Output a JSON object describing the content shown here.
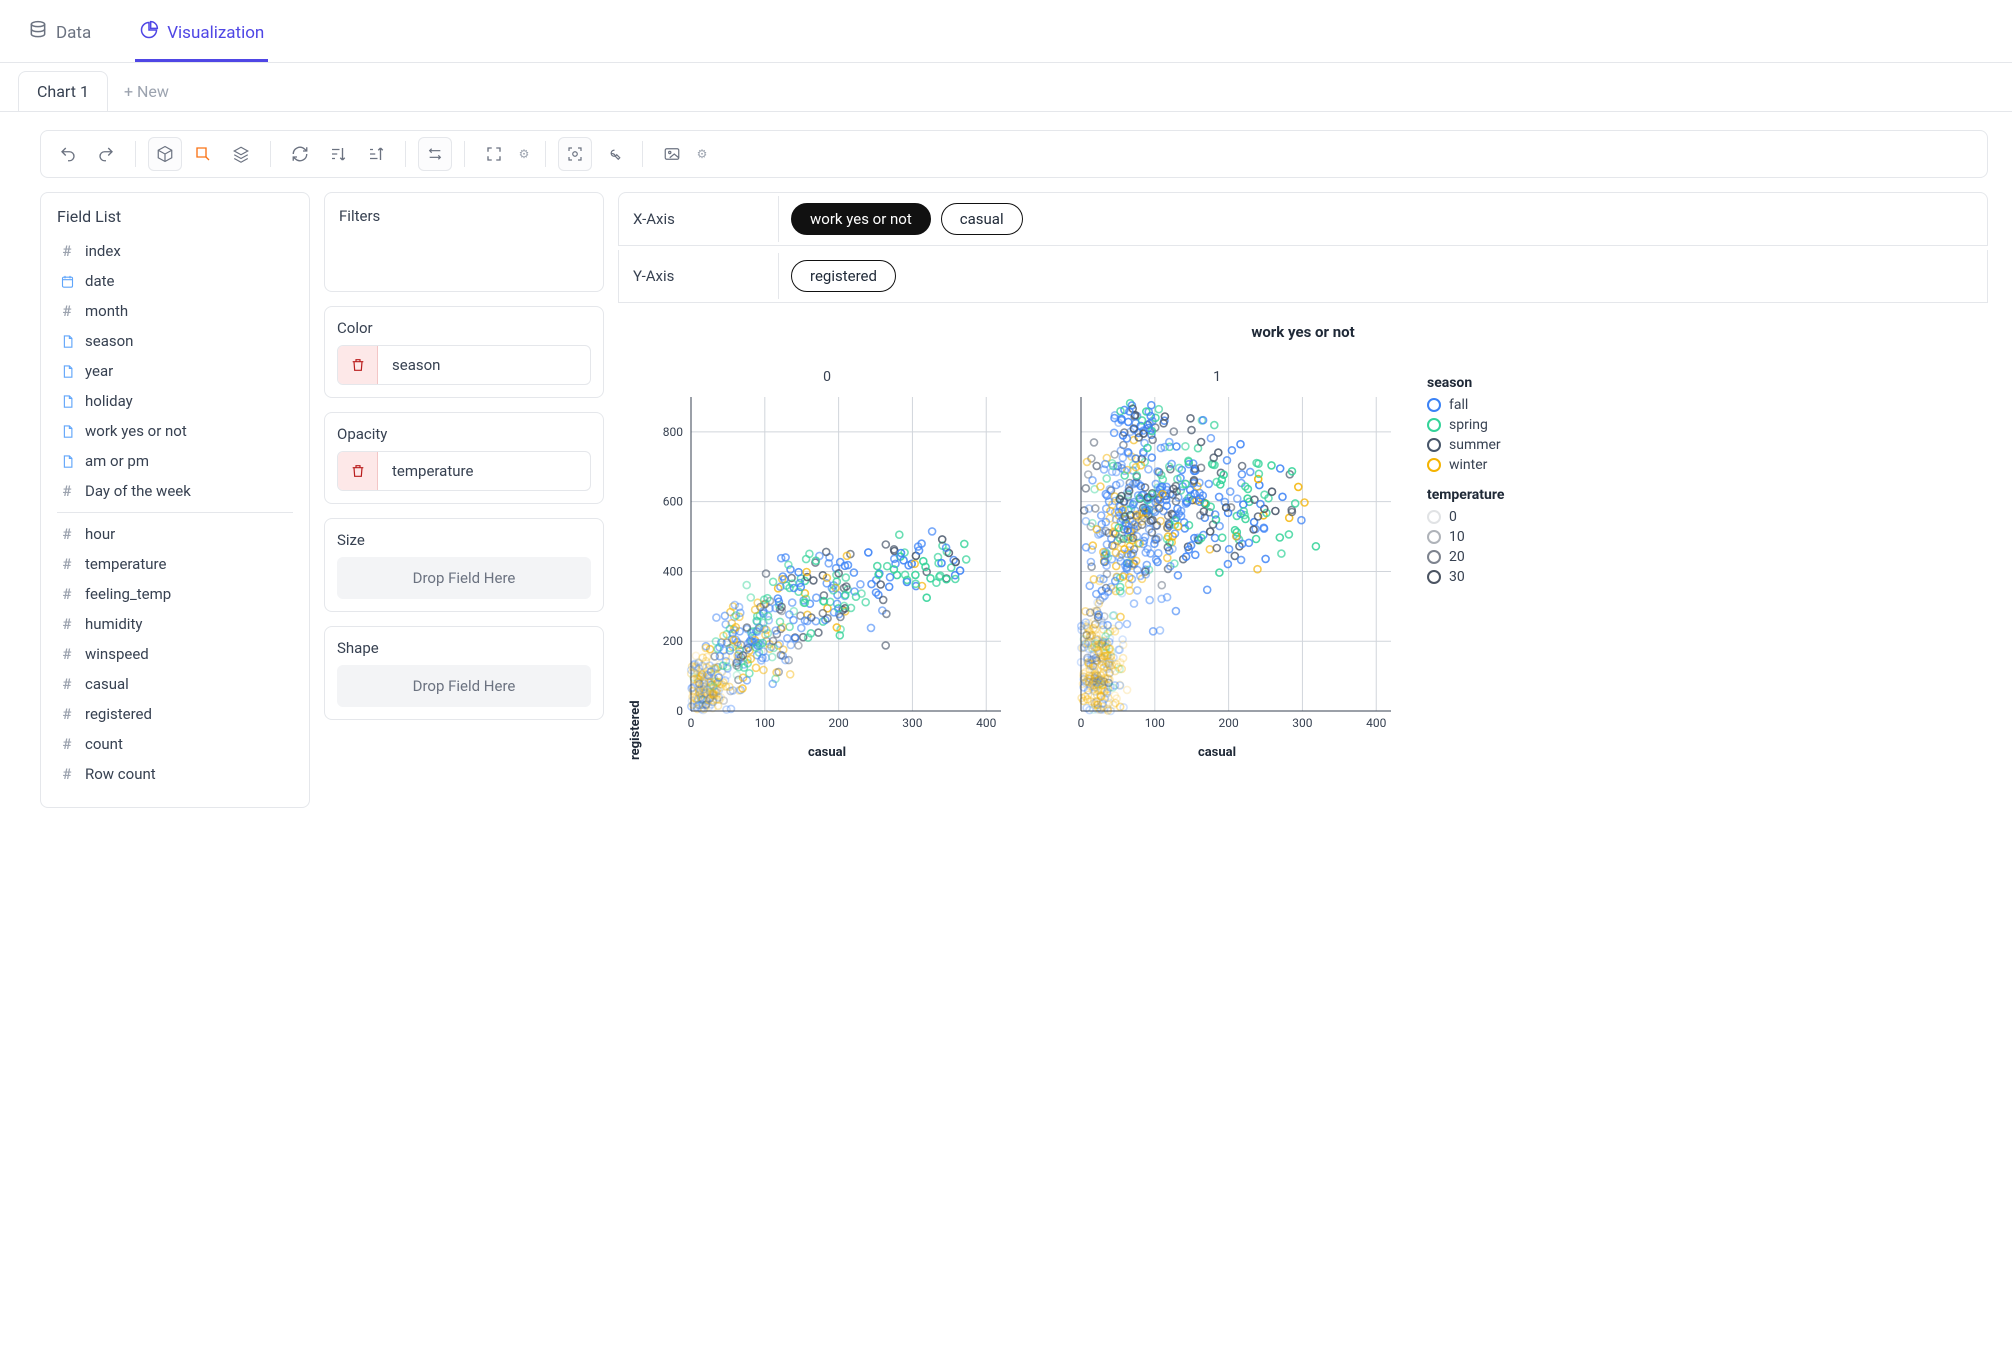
{
  "topTabs": {
    "data": "Data",
    "viz": "Visualization"
  },
  "subTabs": {
    "chart1": "Chart 1",
    "new": "+ New"
  },
  "fieldList": {
    "title": "Field List",
    "groups": [
      [
        {
          "icon": "hash",
          "label": "index"
        },
        {
          "icon": "cal",
          "label": "date"
        },
        {
          "icon": "hash",
          "label": "month"
        },
        {
          "icon": "doc",
          "label": "season"
        },
        {
          "icon": "doc",
          "label": "year"
        },
        {
          "icon": "doc",
          "label": "holiday"
        },
        {
          "icon": "doc",
          "label": "work yes or not"
        },
        {
          "icon": "doc",
          "label": "am or pm"
        },
        {
          "icon": "hash",
          "label": "Day of the week"
        }
      ],
      [
        {
          "icon": "hash",
          "label": "hour"
        },
        {
          "icon": "hash",
          "label": "temperature"
        },
        {
          "icon": "hash",
          "label": "feeling_temp"
        },
        {
          "icon": "hash",
          "label": "humidity"
        },
        {
          "icon": "hash",
          "label": "winspeed"
        },
        {
          "icon": "hash",
          "label": "casual"
        },
        {
          "icon": "hash",
          "label": "registered"
        },
        {
          "icon": "hash",
          "label": "count"
        },
        {
          "icon": "hash",
          "label": "Row count"
        }
      ]
    ]
  },
  "shelves": {
    "filters": "Filters",
    "color": {
      "title": "Color",
      "value": "season"
    },
    "opacity": {
      "title": "Opacity",
      "value": "temperature"
    },
    "size": {
      "title": "Size",
      "placeholder": "Drop Field Here"
    },
    "shape": {
      "title": "Shape",
      "placeholder": "Drop Field Here"
    }
  },
  "axes": {
    "x": {
      "label": "X-Axis",
      "pills": [
        {
          "text": "work yes or not",
          "dark": true
        },
        {
          "text": "casual",
          "dark": false
        }
      ]
    },
    "y": {
      "label": "Y-Axis",
      "pills": [
        {
          "text": "registered",
          "dark": false
        }
      ]
    }
  },
  "chart_data": {
    "type": "scatter",
    "facet_title": "work yes or not",
    "facets": [
      "0",
      "1"
    ],
    "xlabel": "casual",
    "ylabel": "registered",
    "x_ticks": [
      0,
      100,
      200,
      300,
      400
    ],
    "y_ticks": [
      0,
      200,
      400,
      600,
      800
    ],
    "xlim": [
      0,
      420
    ],
    "ylim": [
      0,
      900
    ],
    "color_field": "season",
    "color_domain": [
      "fall",
      "spring",
      "summer",
      "winter"
    ],
    "color_range": [
      "#3b82f6",
      "#34d399",
      "#475569",
      "#f5b301"
    ],
    "opacity_field": "temperature",
    "opacity_domain": [
      0,
      10,
      20,
      30
    ],
    "opacity_range": [
      0.15,
      0.4,
      0.65,
      0.9
    ],
    "legend": {
      "season": {
        "title": "season",
        "items": [
          "fall",
          "spring",
          "summer",
          "winter"
        ]
      },
      "temperature": {
        "title": "temperature",
        "items": [
          "0",
          "10",
          "20",
          "30"
        ]
      }
    },
    "series": [
      {
        "facet": "0",
        "points_approx": {
          "clusters": [
            {
              "cx": 20,
              "cy": 60,
              "n": 220,
              "spreadx": 35,
              "spready": 90,
              "season_mix": {
                "winter": 0.55,
                "fall": 0.3,
                "summer": 0.1,
                "spring": 0.05
              },
              "temp_center": 5
            },
            {
              "cx": 80,
              "cy": 200,
              "n": 160,
              "spreadx": 60,
              "spready": 120,
              "season_mix": {
                "fall": 0.45,
                "winter": 0.25,
                "spring": 0.15,
                "summer": 0.15
              },
              "temp_center": 15
            },
            {
              "cx": 180,
              "cy": 340,
              "n": 120,
              "spreadx": 80,
              "spready": 120,
              "season_mix": {
                "fall": 0.4,
                "spring": 0.3,
                "summer": 0.2,
                "winter": 0.1
              },
              "temp_center": 22
            },
            {
              "cx": 300,
              "cy": 420,
              "n": 60,
              "spreadx": 70,
              "spready": 100,
              "season_mix": {
                "spring": 0.4,
                "fall": 0.35,
                "summer": 0.2,
                "winter": 0.05
              },
              "temp_center": 26
            }
          ]
        }
      },
      {
        "facet": "1",
        "points_approx": {
          "clusters": [
            {
              "cx": 25,
              "cy": 120,
              "n": 300,
              "spreadx": 30,
              "spready": 180,
              "season_mix": {
                "winter": 0.6,
                "fall": 0.25,
                "summer": 0.1,
                "spring": 0.05
              },
              "temp_center": 5
            },
            {
              "cx": 60,
              "cy": 520,
              "n": 260,
              "spreadx": 55,
              "spready": 240,
              "season_mix": {
                "fall": 0.55,
                "winter": 0.2,
                "summer": 0.15,
                "spring": 0.1
              },
              "temp_center": 15
            },
            {
              "cx": 120,
              "cy": 620,
              "n": 180,
              "spreadx": 80,
              "spready": 200,
              "season_mix": {
                "fall": 0.5,
                "summer": 0.25,
                "spring": 0.2,
                "winter": 0.05
              },
              "temp_center": 22
            },
            {
              "cx": 220,
              "cy": 560,
              "n": 100,
              "spreadx": 100,
              "spready": 180,
              "season_mix": {
                "spring": 0.35,
                "fall": 0.35,
                "summer": 0.25,
                "winter": 0.05
              },
              "temp_center": 26
            },
            {
              "cx": 80,
              "cy": 820,
              "n": 40,
              "spreadx": 40,
              "spready": 60,
              "season_mix": {
                "fall": 0.7,
                "summer": 0.2,
                "spring": 0.1,
                "winter": 0.0
              },
              "temp_center": 24
            }
          ]
        }
      }
    ]
  }
}
